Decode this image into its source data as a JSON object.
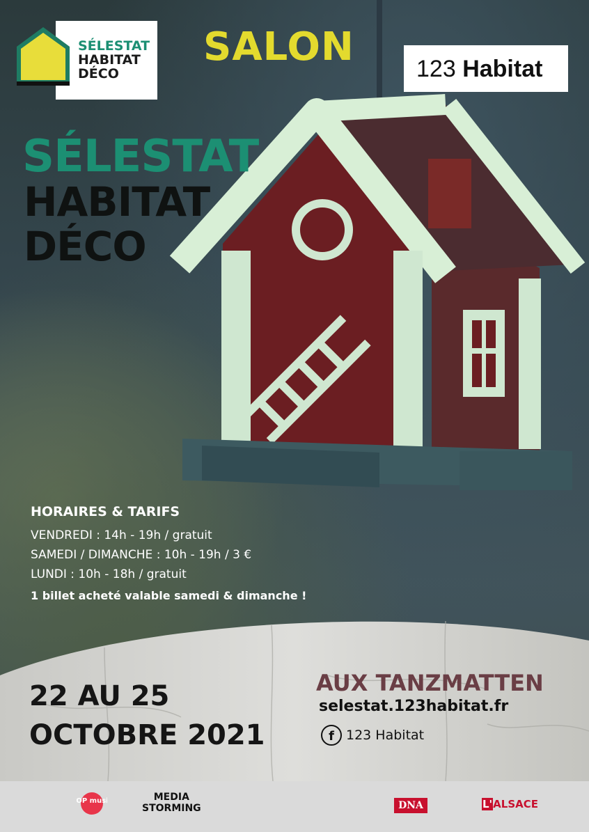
{
  "logo": {
    "line1": "SÉLESTAT",
    "line2": "HABITAT",
    "line3": "DÉCO"
  },
  "salon": "SALON",
  "brand": {
    "num": "123",
    "word": "Habitat"
  },
  "title": {
    "line1": "SÉLESTAT",
    "line2": "HABITAT",
    "line3": "DÉCO"
  },
  "hours": {
    "heading": "HORAIRES & TARIFS",
    "rows": [
      "VENDREDI : 14h - 19h / gratuit",
      "SAMEDI / DIMANCHE : 10h - 19h / 3 €",
      "LUNDI : 10h - 18h / gratuit"
    ],
    "note": "1 billet acheté valable samedi & dimanche !"
  },
  "date": {
    "line1": "22 AU 25",
    "line2": "OCTOBRE 2021"
  },
  "venue": "AUX TANZMATTEN",
  "website": "selestat.123habitat.fr",
  "facebook": "123 Habitat",
  "sponsors": {
    "topmusic": "TOP music",
    "media1": "MEDIA",
    "media2": "STORMING",
    "dna": "DNA",
    "alsace_prefix": "L'",
    "alsace": "ALSACE"
  },
  "colors": {
    "accent_green": "#1c8f73",
    "salon_yellow": "#e3da2e",
    "venue": "#6a3e45"
  }
}
